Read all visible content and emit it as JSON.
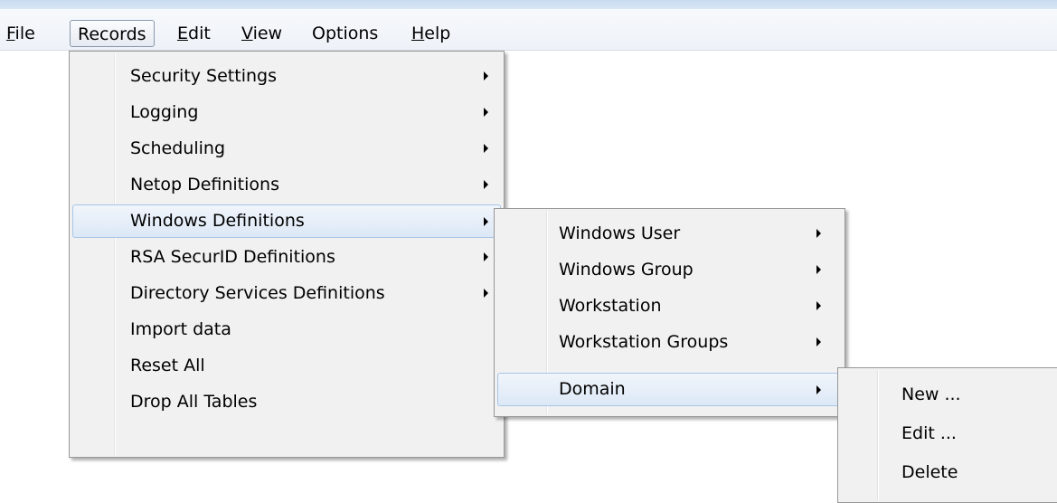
{
  "menubar": {
    "items": [
      {
        "label": "File",
        "mnemonic": "F",
        "rest": "ile"
      },
      {
        "label": "Records"
      },
      {
        "label": "Edit",
        "mnemonic": "E",
        "rest": "dit"
      },
      {
        "label": "View",
        "mnemonic": "V",
        "rest": "iew"
      },
      {
        "label": "Options"
      },
      {
        "label": "Help",
        "mnemonic": "H",
        "rest": "elp"
      }
    ]
  },
  "records_menu": {
    "items": [
      {
        "label": "Security Settings",
        "submenu": true
      },
      {
        "label": "Logging",
        "submenu": true
      },
      {
        "label": "Scheduling",
        "submenu": true
      },
      {
        "label": "Netop Definitions",
        "submenu": true
      },
      {
        "label": "Windows Definitions",
        "submenu": true,
        "highlighted": true
      },
      {
        "label": "RSA SecurID Definitions",
        "submenu": true
      },
      {
        "label": "Directory Services Definitions",
        "submenu": true
      },
      {
        "label": "Import data",
        "submenu": false
      },
      {
        "label": "Reset All",
        "submenu": false
      },
      {
        "label": "Drop All Tables",
        "submenu": false
      }
    ]
  },
  "windows_menu": {
    "items": [
      {
        "label": "Windows User",
        "submenu": true
      },
      {
        "label": "Windows Group",
        "submenu": true
      },
      {
        "label": "Workstation",
        "submenu": true
      },
      {
        "label": "Workstation Groups",
        "submenu": true
      },
      {
        "label": "Domain",
        "submenu": true,
        "highlighted": true
      }
    ]
  },
  "domain_menu": {
    "items": [
      {
        "label": "New ..."
      },
      {
        "label": "Edit ..."
      },
      {
        "label": "Delete"
      }
    ]
  }
}
